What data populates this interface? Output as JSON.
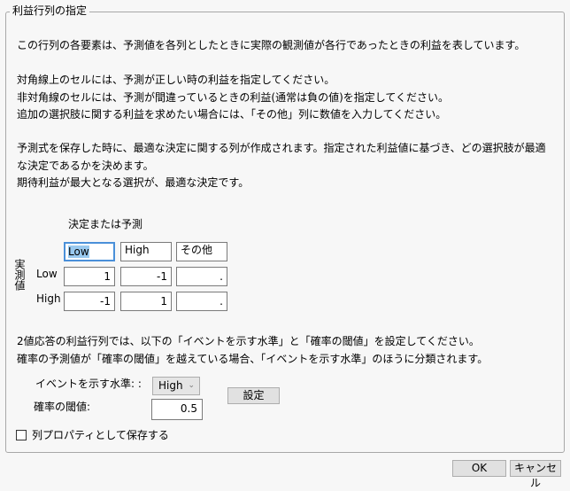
{
  "group_title": "利益行列の指定",
  "paragraphs": {
    "intro": "この行列の各要素は、予測値を各列としたときに実際の観測値が各行であったときの利益を表しています。",
    "diag": "対角線上のセルには、予測が正しい時の利益を指定してください。",
    "offdiag": "非対角線のセルには、予測が間違っているときの利益(通常は負の値)を指定してください。",
    "other": "追加の選択肢に関する利益を求めたい場合には、「その他」列に数値を入力してください。",
    "save1": "予測式を保存した時に、最適な決定に関する列が作成されます。指定された利益値に基づき、どの選択肢が最適",
    "save2": "な決定であるかを決めます。",
    "expect": "期待利益が最大となる選択が、最適な決定です。",
    "binary1": "2値応答の利益行列では、以下の「イベントを示す水準」と「確率の閾値」を設定してください。",
    "binary2": "確率の予測値が「確率の閾値」を越えている場合、「イベントを示す水準」のほうに分類されます。"
  },
  "matrix": {
    "column_header": "決定または予測",
    "row_header": "実測値",
    "columns": [
      "Low",
      "High",
      "その他"
    ],
    "rows": [
      {
        "label": "Low",
        "values": [
          "1",
          "-1",
          "."
        ]
      },
      {
        "label": "High",
        "values": [
          "-1",
          "1",
          "."
        ]
      }
    ]
  },
  "event_level": {
    "label": "イベントを示す水準: :",
    "value": "High"
  },
  "threshold": {
    "label": "確率の閾値:",
    "value": "0.5"
  },
  "set_button": "設定",
  "save_property": {
    "label": "列プロパティとして保存する",
    "checked": false
  },
  "ok_button": "OK",
  "cancel_button": "キャンセル"
}
